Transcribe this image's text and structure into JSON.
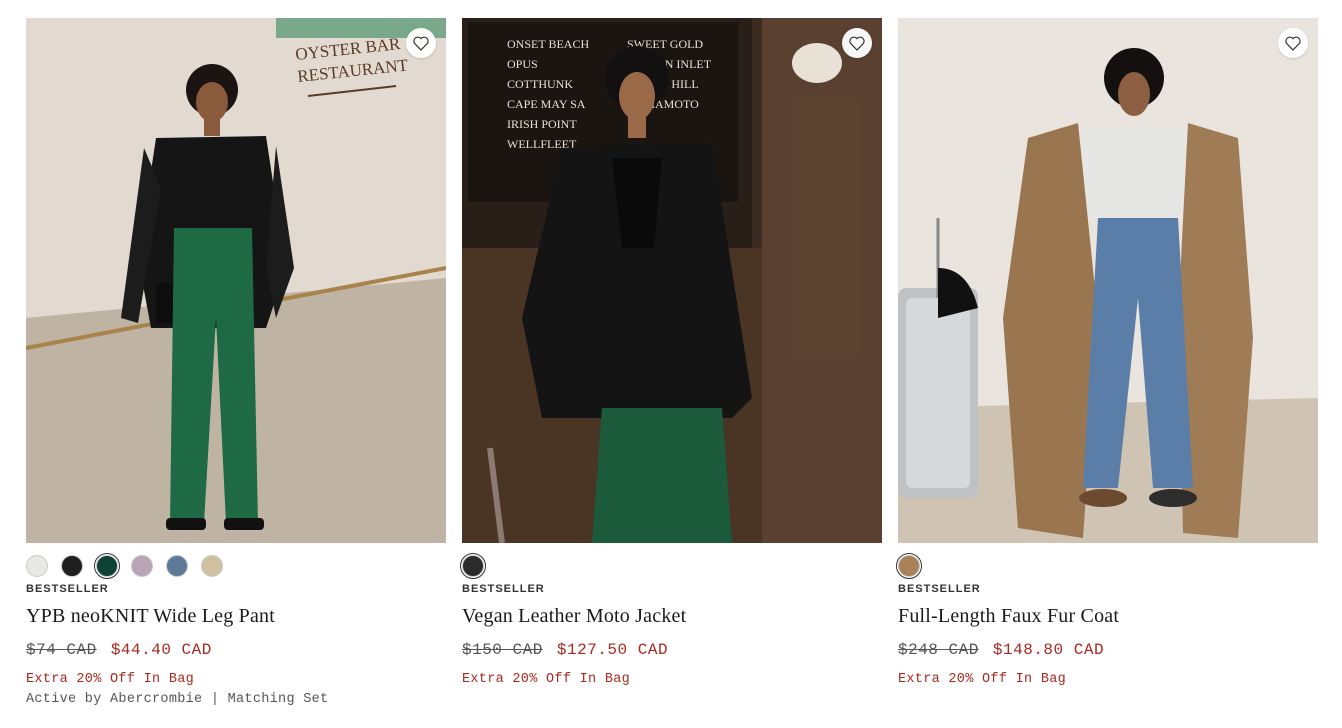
{
  "products": [
    {
      "name": "YPB neoKNIT Wide Leg Pant",
      "badge": "BESTSELLER",
      "original_price": "$74 CAD",
      "sale_price": "$44.40 CAD",
      "promo": "Extra 20% Off In Bag",
      "extra_info": "Active by Abercrombie | Matching Set",
      "wishlist_icon": "heart-outline-icon",
      "swatches": [
        "#e8e8e2",
        "#1f1f1f",
        "#0f4236",
        "#b9a4b8",
        "#5f7a99",
        "#cfc0a0"
      ],
      "selected_swatch": 2
    },
    {
      "name": "Vegan Leather Moto Jacket",
      "badge": "BESTSELLER",
      "original_price": "$150 CAD",
      "sale_price": "$127.50 CAD",
      "promo": "Extra 20% Off In Bag",
      "wishlist_icon": "heart-outline-icon",
      "swatches": [
        "#2b2b2b"
      ],
      "selected_swatch": 0
    },
    {
      "name": "Full-Length Faux Fur Coat",
      "badge": "BESTSELLER",
      "original_price": "$248 CAD",
      "sale_price": "$148.80 CAD",
      "promo": "Extra 20% Off In Bag",
      "wishlist_icon": "heart-outline-icon",
      "swatches": [
        "#a9825a"
      ],
      "selected_swatch": 0
    }
  ],
  "photo_text": {
    "sign_line1": "OYSTER BAR",
    "sign_line2": "RESTAURANT",
    "menu_board": [
      "ONSET BEACH",
      "OPUS",
      "COTTHUNK",
      "CAPE MAY SA",
      "IRISH POINT",
      "WELLFLEET",
      "SWEET GOLD",
      "TOTTEN INLET",
      "WATCH HILL",
      "KUMAMOTO"
    ]
  },
  "colors": {
    "sale": "#a8291f",
    "text": "#1a1a1a",
    "muted": "#555555"
  }
}
